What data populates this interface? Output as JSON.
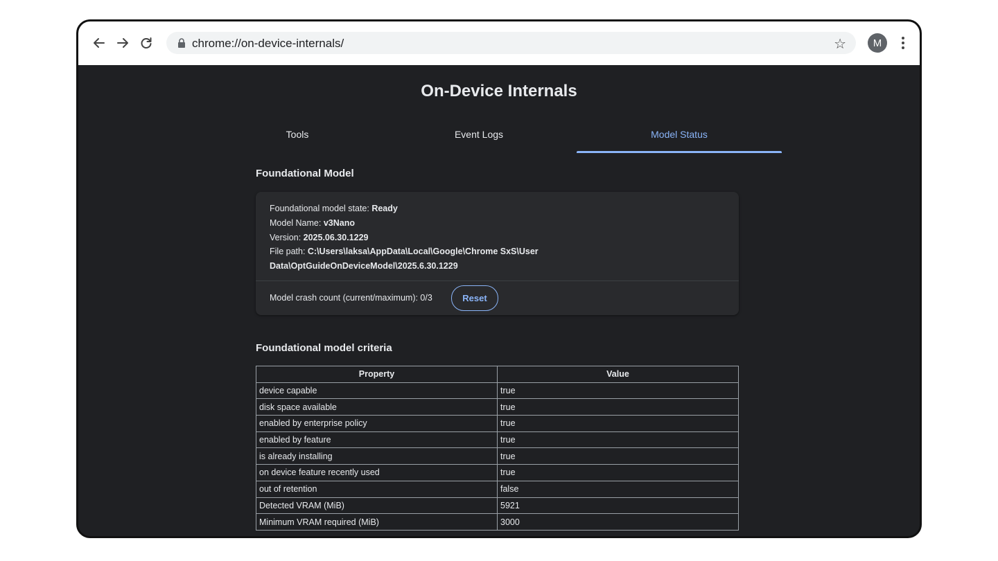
{
  "browser": {
    "url": "chrome://on-device-internals/",
    "profile_initial": "M",
    "icons": {
      "back": "back-arrow-icon",
      "forward": "forward-arrow-icon",
      "reload": "reload-icon",
      "lock": "lock-icon",
      "star": "star-icon",
      "menu": "more-vert-icon"
    }
  },
  "page": {
    "title": "On-Device Internals",
    "tabs": [
      {
        "label": "Tools",
        "active": false
      },
      {
        "label": "Event Logs",
        "active": false
      },
      {
        "label": "Model Status",
        "active": true
      }
    ],
    "foundational_model": {
      "heading": "Foundational Model",
      "state_label": "Foundational model state: ",
      "state_value": "Ready",
      "name_label": "Model Name: ",
      "name_value": "v3Nano",
      "version_label": "Version: ",
      "version_value": "2025.06.30.1229",
      "path_label": "File path: ",
      "path_value_line1": "C:\\Users\\laksa\\AppData\\Local\\Google\\Chrome SxS\\User",
      "path_value_line2": "Data\\OptGuideOnDeviceModel\\2025.6.30.1229",
      "crash_count_text": "Model crash count (current/maximum): 0/3",
      "reset_label": "Reset"
    },
    "criteria": {
      "heading": "Foundational model criteria",
      "columns": [
        "Property",
        "Value"
      ],
      "rows": [
        [
          "device capable",
          "true"
        ],
        [
          "disk space available",
          "true"
        ],
        [
          "enabled by enterprise policy",
          "true"
        ],
        [
          "enabled by feature",
          "true"
        ],
        [
          "is already installing",
          "true"
        ],
        [
          "on device feature recently used",
          "true"
        ],
        [
          "out of retention",
          "false"
        ],
        [
          "Detected VRAM (MiB)",
          "5921"
        ],
        [
          "Minimum VRAM required (MiB)",
          "3000"
        ]
      ]
    }
  },
  "colors": {
    "page_bg": "#1f2023",
    "card_bg": "#292a2d",
    "accent": "#8ab4f8",
    "text": "#e8eaed"
  }
}
